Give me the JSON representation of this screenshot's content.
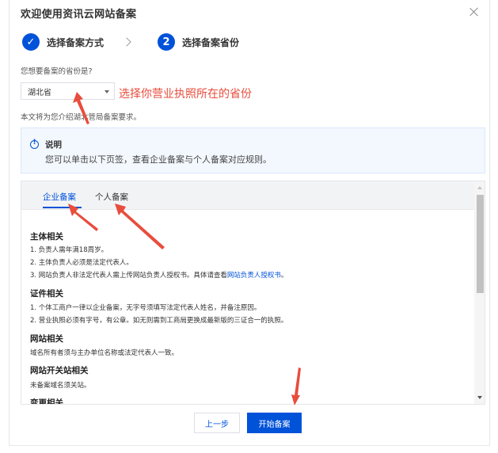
{
  "dialog": {
    "title": "欢迎使用资讯云网站备案",
    "close_icon": "close-icon"
  },
  "steps": [
    {
      "marker": "✓",
      "label": "选择备案方式",
      "state": "done"
    },
    {
      "marker": "2",
      "label": "选择备案省份",
      "state": "active"
    }
  ],
  "question": "您想要备案的省份是?",
  "province_select": {
    "value": "湖北省"
  },
  "annotation_province": "选择你营业执照所在的省份",
  "description": "本文将为您介绍湖北管局备案要求。",
  "notice": {
    "title": "说明",
    "text": "您可以单击以下页签，查看企业备案与个人备案对应规则。",
    "icon": "info-icon"
  },
  "tabs": [
    {
      "label": "企业备案",
      "active": true
    },
    {
      "label": "个人备案",
      "active": false
    }
  ],
  "sections": [
    {
      "title": "主体相关",
      "items": [
        "1. 负责人需年满18周岁。",
        "2. 主体负责人必须是法定代表人。",
        "3. 网站负责人非法定代表人需上传网站负责人授权书。具体请查看"
      ],
      "link": "网站负责人授权书",
      "link_suffix": "。"
    },
    {
      "title": "证件相关",
      "items": [
        "1. 个体工商户一律以企业备案，无字号须填写法定代表人姓名，并备注原因。",
        "2. 营业执照必须有字号，有公章。如无则需到工商局更换成最新版的三证合一的执照。"
      ]
    },
    {
      "title": "网站相关",
      "items": [
        "域名所有者须与主办单位名称或法定代表人一致。"
      ]
    },
    {
      "title": "网站开关站相关",
      "items": [
        "未备案域名须关站。"
      ]
    },
    {
      "title": "变更相关",
      "items": []
    }
  ],
  "buttons": {
    "prev": "上一步",
    "start": "开始备案"
  },
  "colors": {
    "primary": "#0052d9",
    "annotation": "#e84d3d"
  }
}
